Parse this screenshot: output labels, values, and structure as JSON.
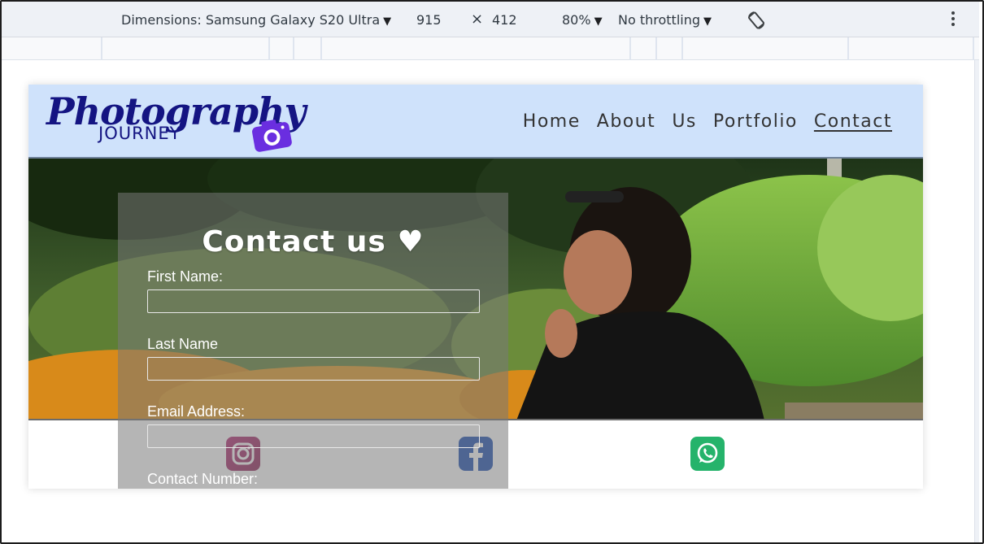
{
  "devtools": {
    "dimensions_label": "Dimensions: Samsung Galaxy S20 Ultra",
    "width": "915",
    "times": "×",
    "height": "412",
    "zoom": "80%",
    "throttling": "No throttling",
    "caret": "▼",
    "icons": [
      "rotate-icon",
      "more-options-icon"
    ]
  },
  "site": {
    "logo_main": "Photography",
    "logo_sub": "JOURNEY",
    "nav": [
      {
        "label": "Home"
      },
      {
        "label": "About"
      },
      {
        "label": "Us"
      },
      {
        "label": "Portfolio"
      },
      {
        "label": "Contact",
        "active": true
      }
    ],
    "hero_image": "woman-in-garden-photo",
    "social_icons": [
      "instagram-icon",
      "facebook-icon",
      "whatsapp-icon"
    ]
  },
  "contact_form": {
    "title": "Contact us ♥",
    "fields": [
      {
        "label": "First Name:",
        "value": ""
      },
      {
        "label": "Last Name",
        "value": ""
      },
      {
        "label": "Email Address:",
        "value": ""
      },
      {
        "label": "Contact Number:"
      }
    ]
  },
  "colors": {
    "nav_bg": "#cfe2fb",
    "logo": "#141482",
    "instagram": "#b42a74",
    "facebook": "#1c4fb2",
    "whatsapp": "#25b36b"
  }
}
